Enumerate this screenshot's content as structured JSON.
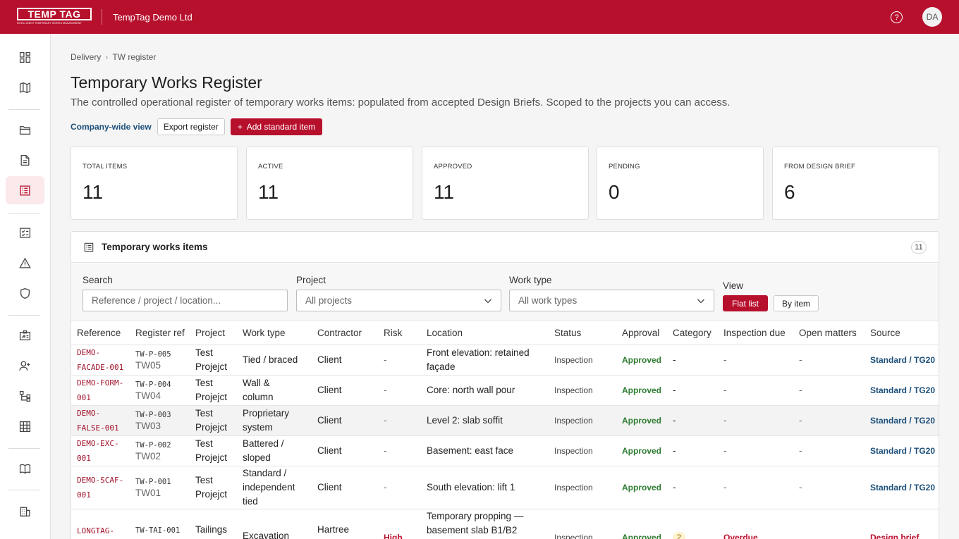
{
  "header": {
    "logo_text": "TEMP TAG",
    "logo_tagline": "INTELLIGENT TEMPORARY WORKS MANAGEMENT",
    "org_name": "TempTag Demo Ltd",
    "help_glyph": "?",
    "avatar_initials": "DA"
  },
  "sidebar": {
    "icons": [
      "dashboard-icon",
      "map-icon",
      "folder-icon",
      "document-icon",
      "register-icon",
      "checklist-icon",
      "warning-icon",
      "shield-icon",
      "id-card-icon",
      "add-user-icon",
      "hierarchy-icon",
      "grid-icon",
      "book-icon",
      "building-icon"
    ]
  },
  "breadcrumb": {
    "items": [
      "Delivery",
      "TW register"
    ],
    "separator": "›"
  },
  "page": {
    "title": "Temporary Works Register",
    "subtitle": "The controlled operational register of temporary works items: populated from accepted Design Briefs. Scoped to the projects you can access."
  },
  "actions": {
    "company_view": "Company-wide view",
    "export": "Export register",
    "add_icon": "+",
    "add": "Add standard item"
  },
  "stats": [
    {
      "label": "TOTAL ITEMS",
      "value": "11"
    },
    {
      "label": "ACTIVE",
      "value": "11"
    },
    {
      "label": "APPROVED",
      "value": "11"
    },
    {
      "label": "PENDING",
      "value": "0"
    },
    {
      "label": "FROM DESIGN BRIEF",
      "value": "6"
    }
  ],
  "panel": {
    "title": "Temporary works items",
    "count": "11"
  },
  "filters": {
    "search_label": "Search",
    "search_placeholder": "Reference / project / location...",
    "project_label": "Project",
    "project_value": "All projects",
    "worktype_label": "Work type",
    "worktype_value": "All work types",
    "view_label": "View",
    "view_flat": "Flat list",
    "view_item": "By item"
  },
  "table": {
    "columns": [
      "Reference",
      "Register ref",
      "Project",
      "Work type",
      "Contractor",
      "Risk",
      "Location",
      "Status",
      "Approval",
      "Category",
      "Inspection due",
      "Open matters",
      "Source"
    ],
    "rows": [
      {
        "ref": [
          "DEMO-",
          "FACADE-001"
        ],
        "reg": "TW-P-005",
        "reg_sub": "TW05",
        "project": [
          "Test",
          "Projejct"
        ],
        "worktype": [
          "Tied / braced"
        ],
        "contractor": "Client",
        "risk": "-",
        "location": [
          "Front elevation: retained",
          "façade"
        ],
        "status": "Inspection",
        "approval": "Approved",
        "category": "-",
        "inspection": "-",
        "matters": "-",
        "source": "Standard / TG20"
      },
      {
        "ref": [
          "DEMO-FORM-",
          "001"
        ],
        "reg": "TW-P-004",
        "reg_sub": "TW04",
        "project": [
          "Test",
          "Projejct"
        ],
        "worktype": [
          "Wall &",
          "column"
        ],
        "contractor": "Client",
        "risk": "-",
        "location": [
          "Core: north wall pour"
        ],
        "status": "Inspection",
        "approval": "Approved",
        "category": "-",
        "inspection": "-",
        "matters": "-",
        "source": "Standard / TG20"
      },
      {
        "ref": [
          "DEMO-",
          "FALSE-001"
        ],
        "reg": "TW-P-003",
        "reg_sub": "TW03",
        "project": [
          "Test",
          "Projejct"
        ],
        "worktype": [
          "Proprietary",
          "system"
        ],
        "contractor": "Client",
        "risk": "-",
        "location": [
          "Level 2: slab soffit"
        ],
        "status": "Inspection",
        "approval": "Approved",
        "category": "-",
        "inspection": "-",
        "matters": "-",
        "source": "Standard / TG20"
      },
      {
        "ref": [
          "DEMO-EXC-",
          "001"
        ],
        "reg": "TW-P-002",
        "reg_sub": "TW02",
        "project": [
          "Test",
          "Projejct"
        ],
        "worktype": [
          "Battered /",
          "sloped"
        ],
        "contractor": "Client",
        "risk": "-",
        "location": [
          "Basement: east face"
        ],
        "status": "Inspection",
        "approval": "Approved",
        "category": "-",
        "inspection": "-",
        "matters": "-",
        "source": "Standard / TG20"
      },
      {
        "ref": [
          "DEMO-SCAF-",
          "001"
        ],
        "reg": "TW-P-001",
        "reg_sub": "TW01",
        "project": [
          "Test",
          "Projejct"
        ],
        "worktype": [
          "Standard /",
          "independent",
          "tied"
        ],
        "contractor": "Client",
        "risk": "-",
        "location": [
          "South elevation: lift 1"
        ],
        "status": "Inspection",
        "approval": "Approved",
        "category": "-",
        "inspection": "-",
        "matters": "-",
        "source": "Standard / TG20"
      },
      {
        "ref": [
          "LONGTAG-"
        ],
        "reg": "TW-TAI-001",
        "reg_sub": "",
        "project": [
          "Tailings"
        ],
        "worktype": [
          "Excavation"
        ],
        "contractor": "Hartree",
        "risk": "High",
        "location": [
          "Temporary propping —",
          "basement slab B1/B2"
        ],
        "status": "Inspection",
        "approval": "Approved",
        "category": "2",
        "inspection": "Overdue",
        "matters": "",
        "source": "Design brief"
      }
    ]
  }
}
